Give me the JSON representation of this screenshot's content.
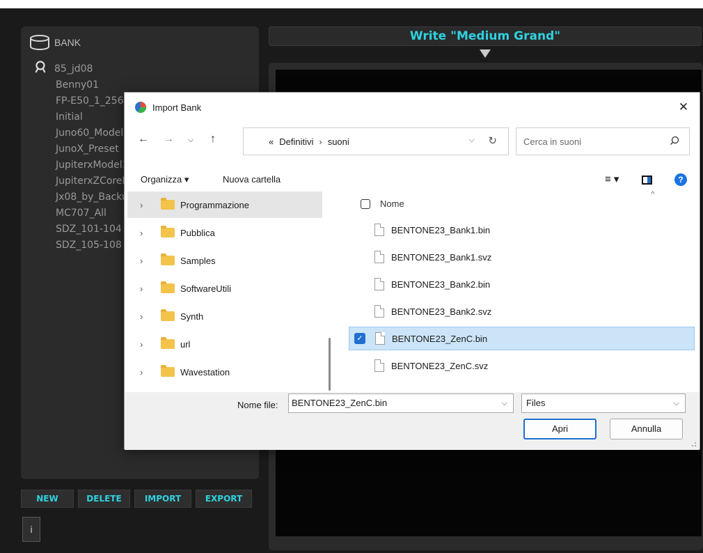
{
  "app": {
    "bank_header": "BANK",
    "bank_items": [
      {
        "label": "85_jd08",
        "icon": "search-user-icon"
      },
      {
        "label": "Benny01"
      },
      {
        "label": "FP-E50_1_256"
      },
      {
        "label": "Initial"
      },
      {
        "label": "Juno60_Model"
      },
      {
        "label": "JunoX_Preset"
      },
      {
        "label": "JupiterxModel1"
      },
      {
        "label": "JupiterxZCoreN"
      },
      {
        "label": "Jx08_by_Backu"
      },
      {
        "label": "MC707_All"
      },
      {
        "label": "SDZ_101-104"
      },
      {
        "label": "SDZ_105-108"
      }
    ],
    "buttons": {
      "new": "NEW",
      "delete": "DELETE",
      "import": "IMPORT",
      "export": "EXPORT"
    },
    "info_label": "i",
    "write_title": "Write \"Medium Grand\"",
    "accent_color": "#2fd1e0"
  },
  "dialog": {
    "title": "Import Bank",
    "close": "✕",
    "address": {
      "prefix": "«",
      "crumbs": [
        "Definitivi",
        "suoni"
      ]
    },
    "search_placeholder": "Cerca in suoni",
    "toolbar": {
      "organize": "Organizza ▾",
      "new_folder": "Nuova cartella",
      "view": "≡ ▾",
      "help": "?"
    },
    "folders": [
      "Programmazione",
      "Pubblica",
      "Samples",
      "SoftwareUtili",
      "Synth",
      "url",
      "Wavestation"
    ],
    "selected_folder": "Programmazione",
    "column_header": "Nome",
    "files": [
      {
        "name": "BENTONE23_Bank1.bin",
        "selected": false
      },
      {
        "name": "BENTONE23_Bank1.svz",
        "selected": false
      },
      {
        "name": "BENTONE23_Bank2.bin",
        "selected": false
      },
      {
        "name": "BENTONE23_Bank2.svz",
        "selected": false
      },
      {
        "name": "BENTONE23_ZenC.bin",
        "selected": true
      },
      {
        "name": "BENTONE23_ZenC.svz",
        "selected": false
      }
    ],
    "filename_label": "Nome file:",
    "filename_value": "BENTONE23_ZenC.bin",
    "filetype_value": "Files",
    "open_label": "Apri",
    "cancel_label": "Annulla"
  }
}
